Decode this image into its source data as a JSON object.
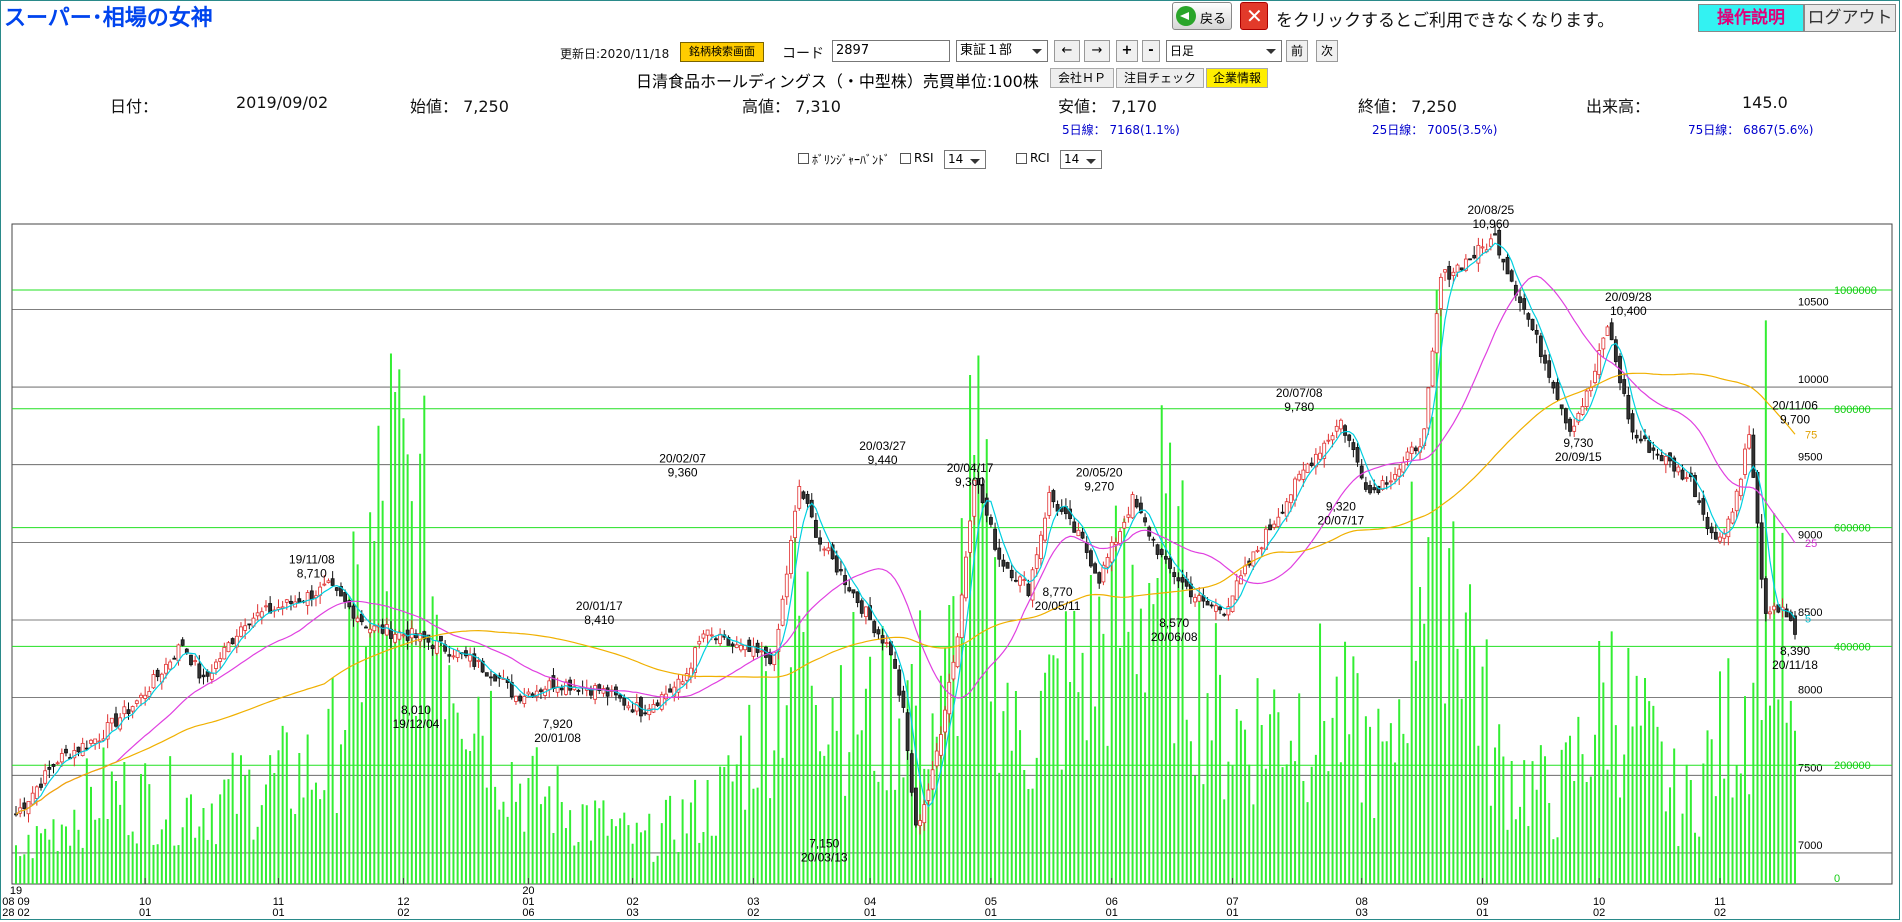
{
  "app": {
    "title": "スーパー･相場の女神"
  },
  "header": {
    "back_label": "戻る",
    "notice": "をクリックするとご利用できなくなります。",
    "help_label": "操作説明",
    "logout_label": "ログアウト"
  },
  "toolbar": {
    "updated": "更新日:2020/11/18",
    "stock_search_label": "銘柄検索画面",
    "code_label": "コード",
    "code_value": "2897",
    "market_value": "東証１部",
    "prev_arrow": "←",
    "next_arrow": "→",
    "zoom_in": "+",
    "zoom_out": "-",
    "period_value": "日足",
    "prev_label": "前",
    "next_label": "次"
  },
  "company": {
    "name": "日清食品ホールディングス（・中型株）売買単位:100株",
    "links": [
      "会社ＨＰ",
      "注目チェック",
      "企業情報"
    ]
  },
  "info": {
    "date_label": "日付：",
    "date": "2019/09/02",
    "open": "始値： 7,250",
    "high": "高値： 7,310",
    "low": "安値： 7,170",
    "close": "終値： 7,250",
    "volume_label": "出来高：",
    "volume": "145.0",
    "ma5": "5日線： 7168(1.1%)",
    "ma25": "25日線： 7005(3.5%)",
    "ma75": "75日線： 6867(5.6%)"
  },
  "options": {
    "bollinger": "ﾎﾞﾘﾝｼﾞｬｰﾊﾞﾝﾄﾞ",
    "rsi": "RSI",
    "rsi_period": "14",
    "rci": "RCI",
    "rci_period": "14"
  },
  "chart_data": {
    "type": "candlestick",
    "price_axis": {
      "ticks": [
        "10500",
        "10000",
        "9500",
        "9000",
        "8500",
        "8000",
        "7500",
        "7000"
      ],
      "range": [
        6800,
        11050
      ]
    },
    "volume_axis": {
      "ticks": [
        "1000000",
        "800000",
        "600000",
        "400000",
        "200000",
        "0"
      ],
      "range": [
        0,
        1000000
      ]
    },
    "x_ticks": [
      {
        "top": "19",
        "mid": "08 09",
        "bot": "28 02"
      },
      {
        "mid": "10",
        "bot": "01"
      },
      {
        "mid": "11",
        "bot": "01"
      },
      {
        "mid": "12",
        "bot": "02"
      },
      {
        "top": "20",
        "mid": "01",
        "bot": "06"
      },
      {
        "mid": "02",
        "bot": "03"
      },
      {
        "mid": "03",
        "bot": "02"
      },
      {
        "mid": "04",
        "bot": "01"
      },
      {
        "mid": "05",
        "bot": "01"
      },
      {
        "mid": "06",
        "bot": "01"
      },
      {
        "mid": "07",
        "bot": "01"
      },
      {
        "mid": "08",
        "bot": "03"
      },
      {
        "mid": "09",
        "bot": "01"
      },
      {
        "mid": "10",
        "bot": "02"
      },
      {
        "mid": "11",
        "bot": "02"
      }
    ],
    "annotations": [
      {
        "date": "19/11/08",
        "value": "8,710",
        "pos": "above"
      },
      {
        "date": "19/12/04",
        "value": "8,010",
        "pos": "below"
      },
      {
        "date": "20/01/08",
        "value": "7,920",
        "pos": "below"
      },
      {
        "date": "20/01/17",
        "value": "8,410",
        "pos": "above"
      },
      {
        "date": "20/02/07",
        "value": "9,360",
        "pos": "above"
      },
      {
        "date": "20/03/13",
        "value": "7,150",
        "pos": "below"
      },
      {
        "date": "20/03/27",
        "value": "9,440",
        "pos": "above"
      },
      {
        "date": "20/04/17",
        "value": "9,300",
        "pos": "above"
      },
      {
        "date": "20/05/11",
        "value": "8,770",
        "pos": "below"
      },
      {
        "date": "20/05/20",
        "value": "9,270",
        "pos": "above"
      },
      {
        "date": "20/06/08",
        "value": "8,570",
        "pos": "below"
      },
      {
        "date": "20/07/08",
        "value": "9,780",
        "pos": "above"
      },
      {
        "date": "20/07/17",
        "value": "9,320",
        "pos": "below"
      },
      {
        "date": "20/08/25",
        "value": "10,960",
        "pos": "above"
      },
      {
        "date": "20/09/15",
        "value": "9,730",
        "pos": "below"
      },
      {
        "date": "20/09/28",
        "value": "10,400",
        "pos": "above"
      },
      {
        "date": "20/11/06",
        "value": "9,700",
        "pos": "above"
      },
      {
        "date": "20/11/18",
        "value": "8,390",
        "pos": "below"
      }
    ],
    "ma_labels": {
      "ma5": "5",
      "ma25": "25",
      "ma75": "75"
    },
    "close_points": [
      [
        0,
        7250
      ],
      [
        10,
        7600
      ],
      [
        20,
        7750
      ],
      [
        30,
        8000
      ],
      [
        40,
        8350
      ],
      [
        45,
        8100
      ],
      [
        55,
        8500
      ],
      [
        65,
        8600
      ],
      [
        75,
        8710
      ],
      [
        85,
        8450
      ],
      [
        95,
        8400
      ],
      [
        105,
        8300
      ],
      [
        115,
        8150
      ],
      [
        120,
        8010
      ],
      [
        130,
        8100
      ],
      [
        140,
        8050
      ],
      [
        150,
        7920
      ],
      [
        160,
        8100
      ],
      [
        165,
        8410
      ],
      [
        175,
        8300
      ],
      [
        182,
        8250
      ],
      [
        188,
        9360
      ],
      [
        193,
        9000
      ],
      [
        198,
        8800
      ],
      [
        205,
        8500
      ],
      [
        210,
        8300
      ],
      [
        213,
        7900
      ],
      [
        216,
        7150
      ],
      [
        220,
        7500
      ],
      [
        226,
        8400
      ],
      [
        230,
        9440
      ],
      [
        236,
        8900
      ],
      [
        243,
        8700
      ],
      [
        248,
        9300
      ],
      [
        256,
        9000
      ],
      [
        260,
        8770
      ],
      [
        268,
        9270
      ],
      [
        276,
        8850
      ],
      [
        285,
        8600
      ],
      [
        290,
        8570
      ],
      [
        300,
        9050
      ],
      [
        310,
        9500
      ],
      [
        318,
        9780
      ],
      [
        325,
        9320
      ],
      [
        333,
        9500
      ],
      [
        338,
        9700
      ],
      [
        342,
        10700
      ],
      [
        350,
        10850
      ],
      [
        355,
        10960
      ],
      [
        362,
        10500
      ],
      [
        368,
        10100
      ],
      [
        373,
        9730
      ],
      [
        378,
        10000
      ],
      [
        382,
        10400
      ],
      [
        388,
        9700
      ],
      [
        395,
        9550
      ],
      [
        402,
        9400
      ],
      [
        408,
        9000
      ],
      [
        412,
        9200
      ],
      [
        416,
        9700
      ],
      [
        420,
        8500
      ],
      [
        424,
        8600
      ],
      [
        427,
        8390
      ]
    ],
    "volume_points": [
      [
        0,
        60000
      ],
      [
        20,
        200000
      ],
      [
        45,
        170000
      ],
      [
        75,
        260000
      ],
      [
        90,
        860000
      ],
      [
        120,
        220000
      ],
      [
        150,
        90000
      ],
      [
        170,
        190000
      ],
      [
        188,
        550000
      ],
      [
        205,
        350000
      ],
      [
        216,
        420000
      ],
      [
        222,
        340000
      ],
      [
        230,
        810000
      ],
      [
        240,
        300000
      ],
      [
        260,
        510000
      ],
      [
        275,
        700000
      ],
      [
        290,
        330000
      ],
      [
        315,
        380000
      ],
      [
        330,
        240000
      ],
      [
        340,
        1000000
      ],
      [
        355,
        260000
      ],
      [
        370,
        180000
      ],
      [
        383,
        430000
      ],
      [
        400,
        160000
      ],
      [
        416,
        420000
      ],
      [
        420,
        860000
      ],
      [
        427,
        230000
      ]
    ]
  }
}
